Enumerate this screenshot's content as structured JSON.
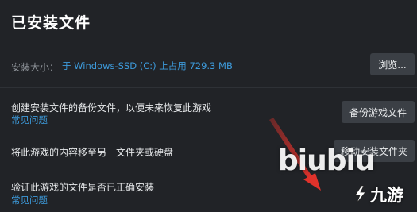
{
  "page": {
    "title": "已安装文件"
  },
  "install_size": {
    "label": "安装大小：",
    "value": "于 Windows-SSD (C:) 上占用 729.3 MB",
    "browse_button": "浏览..."
  },
  "backup": {
    "description": "创建安装文件的备份文件，以便未来恢复此游戏",
    "faq_link": "常见问题",
    "button": "备份游戏文件"
  },
  "move": {
    "description": "将此游戏的内容移至另一文件夹或硬盘",
    "button": "移动安装文件夹"
  },
  "verify": {
    "description": "验证此游戏的文件是否已正确安装",
    "faq_link": "常见问题"
  },
  "watermark": {
    "text": "biubiu"
  },
  "logo": {
    "text": "九游"
  },
  "colors": {
    "background": "#212327",
    "link": "#3d9bdc",
    "button": "#3b3f45",
    "arrow": "#e0322b"
  }
}
